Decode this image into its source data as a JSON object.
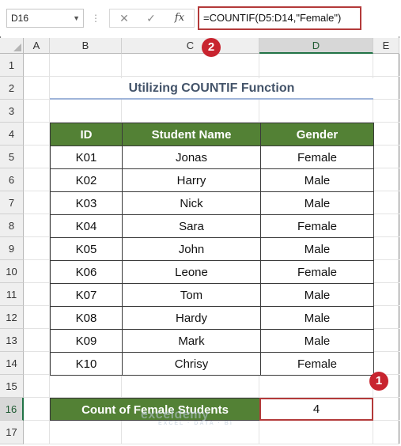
{
  "formula_bar": {
    "name_box": "D16",
    "cancel_icon": "cancel-icon",
    "enter_icon": "check-icon",
    "fx_label": "fx",
    "formula": "=COUNTIF(D5:D14,\"Female\")"
  },
  "grid": {
    "columns": [
      "A",
      "B",
      "C",
      "D",
      "E"
    ],
    "selected_column": "D",
    "rows": [
      "1",
      "2",
      "3",
      "4",
      "5",
      "6",
      "7",
      "8",
      "9",
      "10",
      "11",
      "12",
      "13",
      "14",
      "15",
      "16",
      "17"
    ],
    "selected_row": "16"
  },
  "sheet": {
    "title": "Utilizing COUNTIF Function",
    "table": {
      "headers": [
        "ID",
        "Student Name",
        "Gender"
      ],
      "rows": [
        [
          "K01",
          "Jonas",
          "Female"
        ],
        [
          "K02",
          "Harry",
          "Male"
        ],
        [
          "K03",
          "Nick",
          "Male"
        ],
        [
          "K04",
          "Sara",
          "Female"
        ],
        [
          "K05",
          "John",
          "Male"
        ],
        [
          "K06",
          "Leone",
          "Female"
        ],
        [
          "K07",
          "Tom",
          "Male"
        ],
        [
          "K08",
          "Hardy",
          "Male"
        ],
        [
          "K09",
          "Mark",
          "Male"
        ],
        [
          "K10",
          "Chrisy",
          "Female"
        ]
      ]
    },
    "summary": {
      "label": "Count of Female Students",
      "value": "4"
    }
  },
  "markers": {
    "first": "1",
    "second": "2"
  },
  "watermark": {
    "name": "exceldemy",
    "tagline": "EXCEL · DATA · BI"
  },
  "colors": {
    "header_green": "#538135",
    "title_text": "#44546a",
    "highlight_red": "#b33a3a",
    "marker_red": "#c8242f"
  }
}
